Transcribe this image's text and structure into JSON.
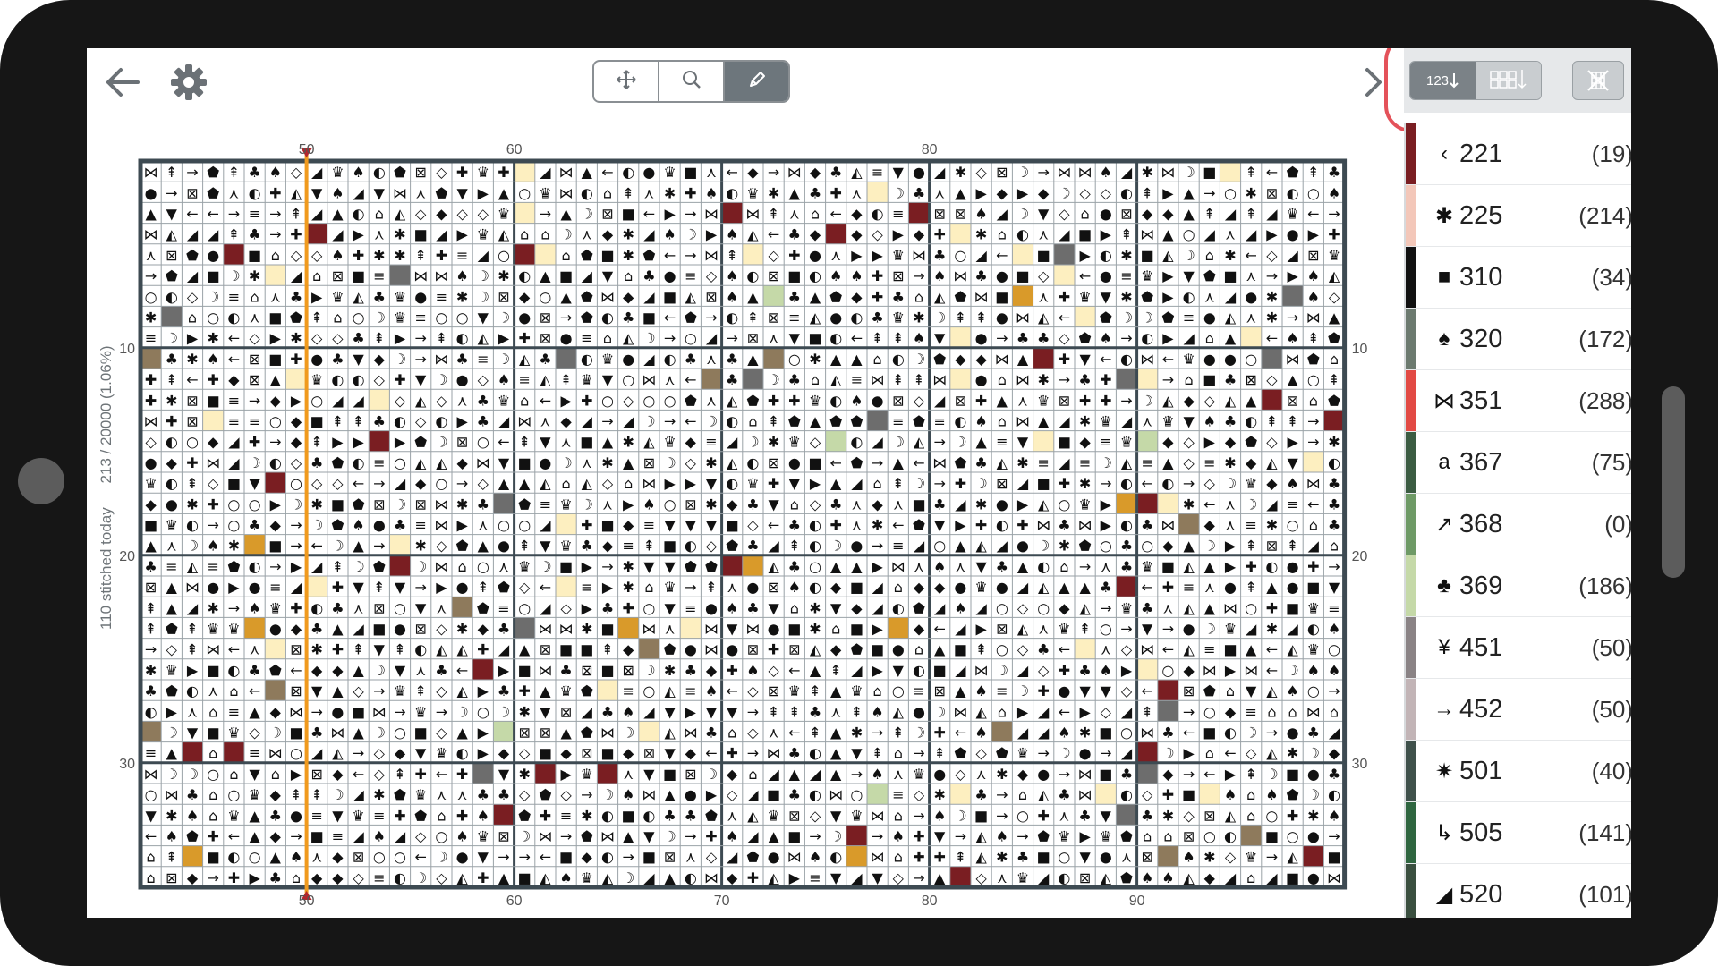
{
  "app": {
    "stitched_today": "110 stitched today",
    "progress": "213 / 20000 (1.06%)"
  },
  "toolbar": {
    "tools": [
      "move-icon",
      "search-icon",
      "pen-icon"
    ],
    "active_tool": "pen-icon",
    "sort_number_label": "123",
    "sort_count_label": "",
    "clear_icon": "clear-icon"
  },
  "colors": {
    "accent": "#e4525a",
    "progress_line": "#f09a1e",
    "grid_major": "#3d4a52",
    "stitched": "#fdefc0"
  },
  "chart_data": {
    "type": "table",
    "top_axis": [
      "50",
      "60",
      "80"
    ],
    "bottom_axis": [
      "50",
      "60",
      "70",
      "80",
      "90"
    ],
    "left_axis": [
      "10",
      "20",
      "30"
    ],
    "right_axis": [
      "10",
      "20",
      "30"
    ],
    "current_column": 50,
    "columns_visible": [
      42,
      100
    ],
    "rows_visible": [
      1,
      36
    ]
  },
  "palette": [
    {
      "symbol": "‹",
      "number": "221",
      "count": "(19)",
      "color": "#7a1e22"
    },
    {
      "symbol": "✱",
      "number": "225",
      "count": "(214)",
      "color": "#f3c7b9"
    },
    {
      "symbol": "■",
      "number": "310",
      "count": "(34)",
      "color": "#111111"
    },
    {
      "symbol": "♠",
      "number": "320",
      "count": "(172)",
      "color": "#6c7a6f"
    },
    {
      "symbol": "⋈",
      "number": "351",
      "count": "(288)",
      "color": "#e24a44"
    },
    {
      "symbol": "a",
      "number": "367",
      "count": "(75)",
      "color": "#3b5c42"
    },
    {
      "symbol": "↗",
      "number": "368",
      "count": "(0)",
      "color": "#6e9a66"
    },
    {
      "symbol": "♣",
      "number": "369",
      "count": "(186)",
      "color": "#c5d9a8"
    },
    {
      "symbol": "¥",
      "number": "451",
      "count": "(50)",
      "color": "#8a8385"
    },
    {
      "symbol": "→",
      "number": "452",
      "count": "(50)",
      "color": "#c2b4b6"
    },
    {
      "symbol": "✷",
      "number": "501",
      "count": "(40)",
      "color": "#3f514b"
    },
    {
      "symbol": "↳",
      "number": "505",
      "count": "(141)",
      "color": "#2f6640"
    },
    {
      "symbol": "◢",
      "number": "520",
      "count": "(101)",
      "color": "#3a4f3f"
    }
  ]
}
